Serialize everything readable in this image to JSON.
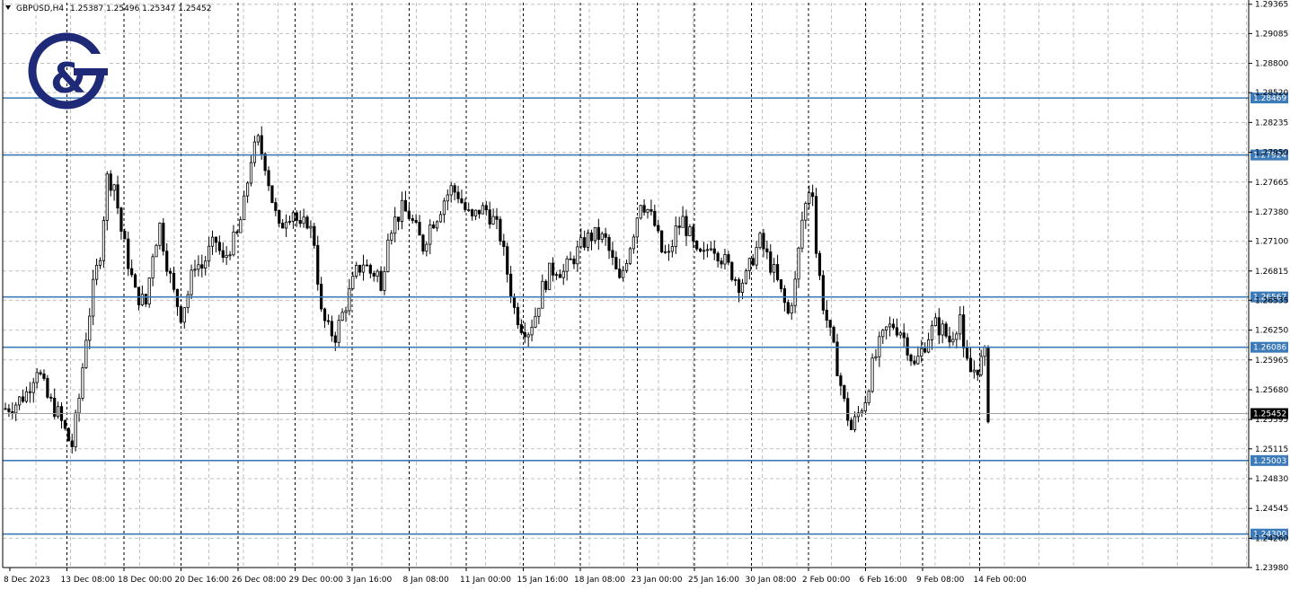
{
  "header": {
    "symbol": "GBPUSD,H4",
    "ohlc": "1.25387 1.25496 1.25347 1.25452"
  },
  "colors": {
    "background": "#ffffff",
    "grid": "#c0c0c0",
    "candle": "#000000",
    "level_line": "#3d7ab8",
    "level_label_bg": "#3d7ab8",
    "current_price_bg": "#000000",
    "logo": "#1e2a78"
  },
  "logo": {
    "icon": "g-ampersand-logo",
    "text": "G&"
  },
  "chart_data": {
    "type": "candlestick",
    "title": "",
    "y_range": [
      1.2398,
      1.2938
    ],
    "y_ticks": [
      "1.29365",
      "1.29085",
      "1.28800",
      "1.28520",
      "1.28235",
      "1.27950",
      "1.27665",
      "1.27380",
      "1.27100",
      "1.26815",
      "1.26535",
      "1.26250",
      "1.25965",
      "1.25680",
      "1.25395",
      "1.25115",
      "1.24830",
      "1.24545",
      "1.24260",
      "1.23980"
    ],
    "x_ticks": [
      "8 Dec 2023",
      "13 Dec 08:00",
      "18 Dec 00:00",
      "20 Dec 16:00",
      "26 Dec 08:00",
      "29 Dec 00:00",
      "3 Jan 16:00",
      "8 Jan 08:00",
      "11 Jan 00:00",
      "15 Jan 16:00",
      "18 Jan 08:00",
      "23 Jan 00:00",
      "25 Jan 16:00",
      "30 Jan 08:00",
      "2 Feb 00:00",
      "6 Feb 16:00",
      "9 Feb 08:00",
      "14 Feb 00:00"
    ],
    "levels": [
      "1.28469",
      "1.27924",
      "1.26567",
      "1.26086",
      "1.25003",
      "1.24300"
    ],
    "current_price": "1.25452",
    "grid": true,
    "close_path": [
      [
        0,
        1.255
      ],
      [
        3,
        1.2555
      ],
      [
        6,
        1.2565
      ],
      [
        9,
        1.259
      ],
      [
        12,
        1.256
      ],
      [
        15,
        1.2545
      ],
      [
        18,
        1.252
      ],
      [
        19,
        1.2515
      ],
      [
        21,
        1.256
      ],
      [
        23,
        1.262
      ],
      [
        25,
        1.2665
      ],
      [
        27,
        1.27
      ],
      [
        29,
        1.277
      ],
      [
        31,
        1.2765
      ],
      [
        33,
        1.272
      ],
      [
        35,
        1.269
      ],
      [
        37,
        1.266
      ],
      [
        40,
        1.265
      ],
      [
        42,
        1.27
      ],
      [
        44,
        1.2725
      ],
      [
        46,
        1.269
      ],
      [
        48,
        1.266
      ],
      [
        50,
        1.264
      ],
      [
        52,
        1.266
      ],
      [
        54,
        1.269
      ],
      [
        56,
        1.2685
      ],
      [
        58,
        1.27
      ],
      [
        60,
        1.271
      ],
      [
        62,
        1.269
      ],
      [
        64,
        1.2705
      ],
      [
        66,
        1.2715
      ],
      [
        68,
        1.2745
      ],
      [
        70,
        1.279
      ],
      [
        72,
        1.2805
      ],
      [
        74,
        1.2785
      ],
      [
        76,
        1.275
      ],
      [
        78,
        1.272
      ],
      [
        80,
        1.2735
      ],
      [
        82,
        1.274
      ],
      [
        84,
        1.272
      ],
      [
        86,
        1.273
      ],
      [
        88,
        1.271
      ],
      [
        90,
        1.264
      ],
      [
        92,
        1.2625
      ],
      [
        94,
        1.262
      ],
      [
        96,
        1.264
      ],
      [
        98,
        1.266
      ],
      [
        100,
        1.268
      ],
      [
        102,
        1.269
      ],
      [
        104,
        1.268
      ],
      [
        106,
        1.268
      ],
      [
        107,
        1.266
      ],
      [
        109,
        1.272
      ],
      [
        111,
        1.273
      ],
      [
        113,
        1.274
      ],
      [
        115,
        1.2735
      ],
      [
        117,
        1.272
      ],
      [
        119,
        1.2705
      ],
      [
        121,
        1.2725
      ],
      [
        123,
        1.2735
      ],
      [
        125,
        1.275
      ],
      [
        127,
        1.276
      ],
      [
        129,
        1.2755
      ],
      [
        131,
        1.274
      ],
      [
        133,
        1.273
      ],
      [
        135,
        1.274
      ],
      [
        137,
        1.274
      ],
      [
        139,
        1.273
      ],
      [
        141,
        1.2715
      ],
      [
        143,
        1.268
      ],
      [
        145,
        1.2645
      ],
      [
        147,
        1.263
      ],
      [
        149,
        1.2625
      ],
      [
        151,
        1.264
      ],
      [
        153,
        1.2665
      ],
      [
        155,
        1.268
      ],
      [
        157,
        1.2685
      ],
      [
        159,
        1.268
      ],
      [
        161,
        1.269
      ],
      [
        163,
        1.27
      ],
      [
        165,
        1.271
      ],
      [
        167,
        1.2715
      ],
      [
        169,
        1.2715
      ],
      [
        171,
        1.271
      ],
      [
        173,
        1.269
      ],
      [
        175,
        1.267
      ],
      [
        177,
        1.2695
      ],
      [
        179,
        1.272
      ],
      [
        181,
        1.275
      ],
      [
        183,
        1.274
      ],
      [
        185,
        1.2725
      ],
      [
        187,
        1.27
      ],
      [
        189,
        1.2695
      ],
      [
        191,
        1.272
      ],
      [
        193,
        1.273
      ],
      [
        195,
        1.2715
      ],
      [
        197,
        1.2695
      ],
      [
        199,
        1.2695
      ],
      [
        201,
        1.271
      ],
      [
        203,
        1.27
      ],
      [
        205,
        1.269
      ],
      [
        207,
        1.268
      ],
      [
        209,
        1.267
      ],
      [
        211,
        1.2675
      ],
      [
        213,
        1.2695
      ],
      [
        215,
        1.271
      ],
      [
        217,
        1.2695
      ],
      [
        219,
        1.268
      ],
      [
        221,
        1.266
      ],
      [
        223,
        1.264
      ],
      [
        225,
        1.267
      ],
      [
        227,
        1.273
      ],
      [
        229,
        1.276
      ],
      [
        230,
        1.276
      ],
      [
        231,
        1.27
      ],
      [
        233,
        1.265
      ],
      [
        235,
        1.262
      ],
      [
        237,
        1.259
      ],
      [
        239,
        1.2555
      ],
      [
        241,
        1.253
      ],
      [
        243,
        1.2545
      ],
      [
        245,
        1.256
      ],
      [
        247,
        1.259
      ],
      [
        249,
        1.261
      ],
      [
        251,
        1.2625
      ],
      [
        253,
        1.263
      ],
      [
        255,
        1.2625
      ],
      [
        257,
        1.261
      ],
      [
        259,
        1.259
      ],
      [
        261,
        1.2605
      ],
      [
        263,
        1.262
      ],
      [
        265,
        1.263
      ],
      [
        267,
        1.2625
      ],
      [
        269,
        1.2615
      ],
      [
        271,
        1.263
      ],
      [
        272,
        1.264
      ],
      [
        273,
        1.26
      ],
      [
        275,
        1.2585
      ],
      [
        277,
        1.259
      ],
      [
        279,
        1.26
      ],
      [
        280,
        1.2545
      ]
    ]
  }
}
